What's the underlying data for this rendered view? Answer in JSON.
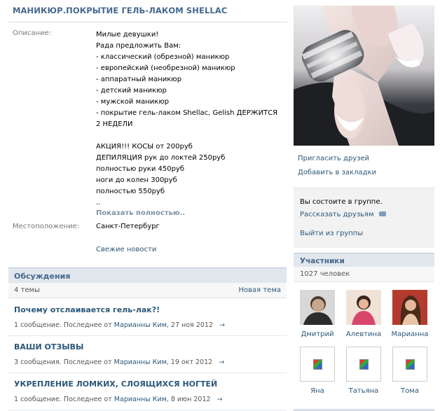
{
  "group": {
    "title": "МАНИКЮР.ПОКРЫТИЕ ГЕЛЬ-ЛАКОМ SHELLAC"
  },
  "info": {
    "description_label": "Описание:",
    "description_lines": [
      "Милые девушки!",
      "Рада предложить Вам:",
      "- классический (обрезной) маникюр",
      "- европейский (необрезной) маникюр",
      "- аппаратный маникюр",
      "- детский маникюр",
      "- мужской маникюр",
      "- покрытие гель-лаком Shellac, Gelish ДЕРЖИТСЯ 2 НЕДЕЛИ",
      "",
      "АКЦИЯ!!! КОСЫ от 200руб",
      "ДЕПИЛЯЦИЯ рук до локтей 250руб",
      "полностью руки 450руб",
      "ноги до колен 300руб",
      "полностью 550руб",
      ".."
    ],
    "show_more": "Показать полностью..",
    "location_label": "Местоположение:",
    "location_value": "Санкт-Петербург",
    "news_link": "Свежие новости"
  },
  "discussions": {
    "header": "Обсуждения",
    "count": "4 темы",
    "new_topic": "Новая тема",
    "topics": [
      {
        "title": "Почему отслаивается гель-лак?!",
        "meta": "1 сообщение. Последнее от",
        "author": "Марианны Ким,",
        "date": "27 ноя 2012"
      },
      {
        "title": "ВАШИ ОТЗЫВЫ",
        "meta": "3 сообщения. Последнее от",
        "author": "Марианны Ким,",
        "date": "19 окт 2012"
      },
      {
        "title": "УКРЕПЛЕНИЕ ЛОМКИХ, СЛОЯЩИХСЯ НОГТЕЙ",
        "meta": "1 сообщение. Последнее от",
        "author": "Марианны Ким,",
        "date": "8 июн 2012"
      }
    ]
  },
  "sidebar": {
    "invite": "Пригласить друзей",
    "bookmark": "Добавить в закладки",
    "member_status": "Вы состоите в группе.",
    "tell_friends": "Рассказать друзьям",
    "leave": "Выйти из группы"
  },
  "members": {
    "header": "Участники",
    "count": "1027 человек",
    "list": [
      {
        "name": "Дмитрий"
      },
      {
        "name": "Алевтина"
      },
      {
        "name": "Марианна"
      },
      {
        "name": "Яна"
      },
      {
        "name": "Татьяна"
      },
      {
        "name": "Тома"
      }
    ]
  },
  "colors": {
    "link": "#2b587a",
    "header_blue": "#45688e",
    "header_bg": "#e1e7ed"
  }
}
